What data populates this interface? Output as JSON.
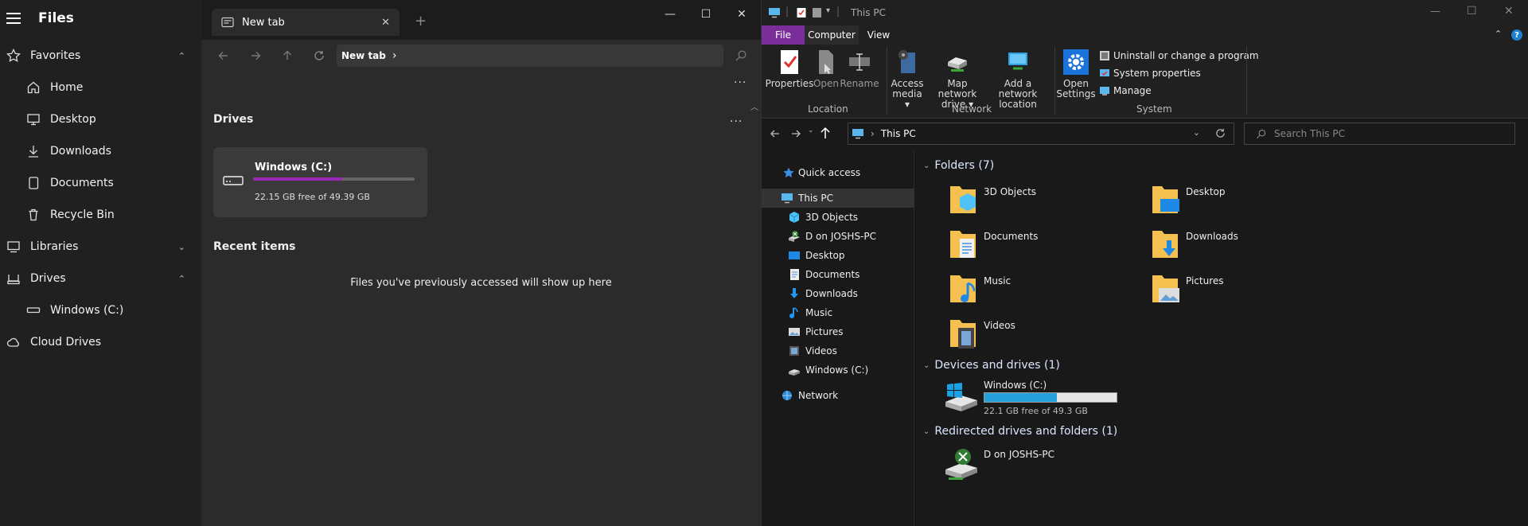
{
  "files_app": {
    "title": "Files",
    "sidebar": {
      "favorites": "Favorites",
      "home": "Home",
      "desktop": "Desktop",
      "downloads": "Downloads",
      "documents": "Documents",
      "recycle_bin": "Recycle Bin",
      "libraries": "Libraries",
      "drives": "Drives",
      "windows_c": "Windows (C:)",
      "cloud_drives": "Cloud Drives"
    },
    "tab": {
      "label": "New tab",
      "add": "+"
    },
    "window_controls": {
      "minimize": "—",
      "maximize": "☐",
      "close": "✕"
    },
    "address": {
      "breadcrumb": "New tab",
      "sep": "›"
    },
    "main": {
      "more": "···",
      "drives_header": "Drives",
      "drive": {
        "name": "Windows (C:)",
        "free": "22.15 GB free of 49.39 GB",
        "used_fraction": 0.552
      },
      "recent_header": "Recent items",
      "recent_empty": "Files you've previously accessed will show up here"
    }
  },
  "explorer": {
    "title": "This PC",
    "ribbon_tabs": {
      "file": "File",
      "computer": "Computer",
      "view": "View"
    },
    "ribbon": {
      "properties": "Properties",
      "open": "Open",
      "rename": "Rename",
      "access_media_1": "Access",
      "access_media_2": "media ▾",
      "map_drive_1": "Map network",
      "map_drive_2": "drive ▾",
      "add_location_1": "Add a network",
      "add_location_2": "location",
      "open_settings_1": "Open",
      "open_settings_2": "Settings",
      "uninstall": "Uninstall or change a program",
      "system_properties": "System properties",
      "manage": "Manage",
      "group_location": "Location",
      "group_network": "Network",
      "group_system": "System"
    },
    "address": {
      "path": "This PC",
      "search_placeholder": "Search This PC"
    },
    "nav": {
      "quick_access": "Quick access",
      "this_pc": "This PC",
      "objects3d": "3D Objects",
      "d_on_pc": "D on JOSHS-PC",
      "desktop": "Desktop",
      "documents": "Documents",
      "downloads": "Downloads",
      "music": "Music",
      "pictures": "Pictures",
      "videos": "Videos",
      "windows_c": "Windows (C:)",
      "network": "Network"
    },
    "content": {
      "folders_header": "Folders (7)",
      "folders": [
        "3D Objects",
        "Desktop",
        "Documents",
        "Downloads",
        "Music",
        "Pictures",
        "Videos"
      ],
      "devices_header": "Devices and drives (1)",
      "drive_name": "Windows (C:)",
      "drive_free": "22.1 GB free of 49.3 GB",
      "drive_used_fraction": 0.55,
      "redirected_header": "Redirected drives and folders (1)",
      "redirected_name": "D on JOSHS-PC"
    }
  },
  "colors": {
    "accent_purple": "#9b26b6",
    "file_tab": "#7b2d9a",
    "explorer_bar": "#26a0da",
    "folder": "#f4c150"
  }
}
